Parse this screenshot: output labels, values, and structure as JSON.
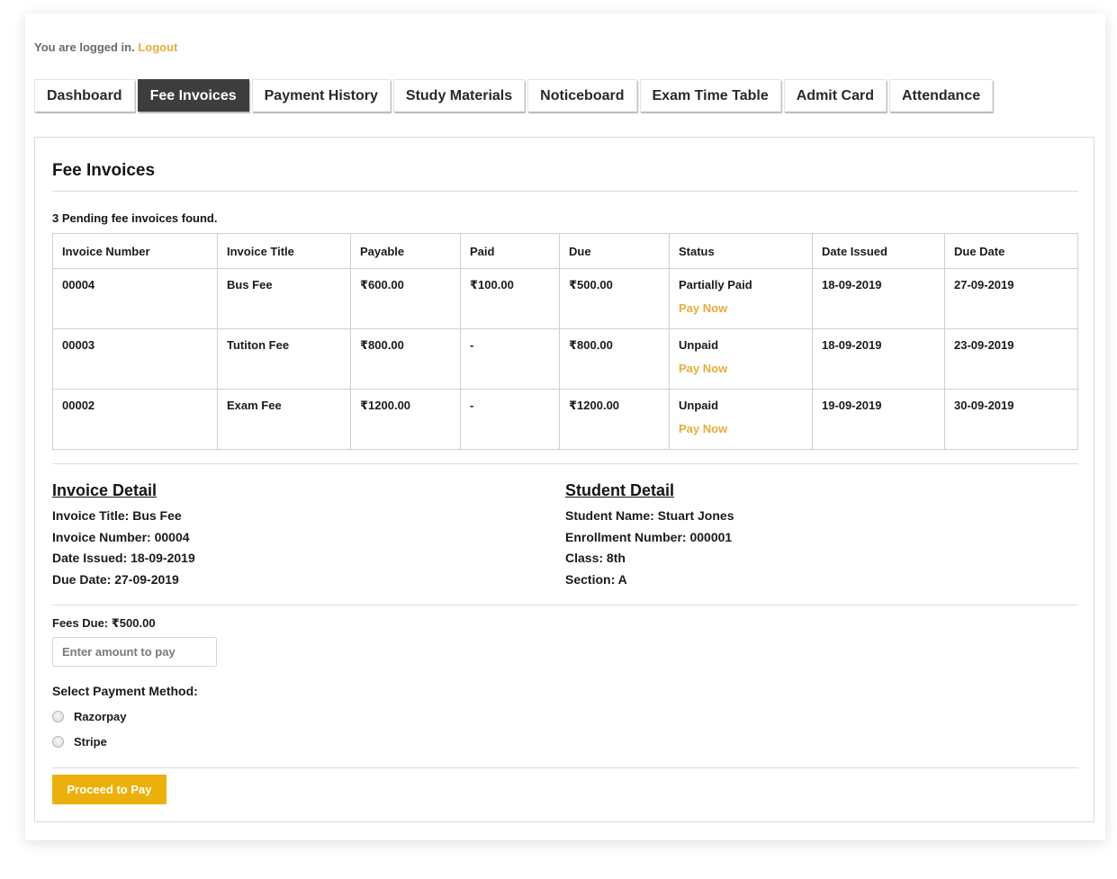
{
  "header": {
    "logged_in_text": "You are logged in.",
    "logout_label": "Logout"
  },
  "tabs": [
    {
      "label": "Dashboard",
      "active": false
    },
    {
      "label": "Fee Invoices",
      "active": true
    },
    {
      "label": "Payment History",
      "active": false
    },
    {
      "label": "Study Materials",
      "active": false
    },
    {
      "label": "Noticeboard",
      "active": false
    },
    {
      "label": "Exam Time Table",
      "active": false
    },
    {
      "label": "Admit Card",
      "active": false
    },
    {
      "label": "Attendance",
      "active": false
    }
  ],
  "panel": {
    "title": "Fee Invoices",
    "pending_text": "3 Pending fee invoices found."
  },
  "table": {
    "columns": [
      "Invoice Number",
      "Invoice Title",
      "Payable",
      "Paid",
      "Due",
      "Status",
      "Date Issued",
      "Due Date"
    ],
    "pay_now_label": "Pay Now",
    "rows": [
      {
        "number": "00004",
        "title": "Bus Fee",
        "payable": "₹600.00",
        "paid": "₹100.00",
        "due": "₹500.00",
        "status": "Partially Paid",
        "date_issued": "18-09-2019",
        "due_date": "27-09-2019"
      },
      {
        "number": "00003",
        "title": "Tutiton Fee",
        "payable": "₹800.00",
        "paid": "-",
        "due": "₹800.00",
        "status": "Unpaid",
        "date_issued": "18-09-2019",
        "due_date": "23-09-2019"
      },
      {
        "number": "00002",
        "title": "Exam Fee",
        "payable": "₹1200.00",
        "paid": "-",
        "due": "₹1200.00",
        "status": "Unpaid",
        "date_issued": "19-09-2019",
        "due_date": "30-09-2019"
      }
    ]
  },
  "invoice_detail": {
    "heading": "Invoice Detail",
    "lines": [
      "Invoice Title: Bus Fee",
      "Invoice Number: 00004",
      "Date Issued: 18-09-2019",
      "Due Date: 27-09-2019"
    ]
  },
  "student_detail": {
    "heading": "Student Detail",
    "lines": [
      "Student Name: Stuart Jones",
      "Enrollment Number: 000001",
      "Class: 8th",
      "Section: A"
    ]
  },
  "payment": {
    "fees_due_text": "Fees Due: ₹500.00",
    "amount_value": "",
    "amount_placeholder": "Enter amount to pay",
    "method_label": "Select Payment Method:",
    "methods": [
      "Razorpay",
      "Stripe"
    ],
    "proceed_label": "Proceed to Pay"
  },
  "colors": {
    "accent_link": "#e8ad3a",
    "button": "#ebb00b",
    "active_tab": "#3d3d3d"
  }
}
